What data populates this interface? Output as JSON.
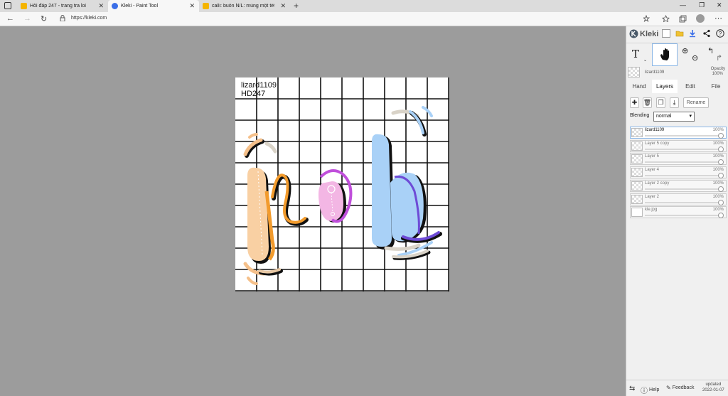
{
  "browser": {
    "tabs": [
      {
        "title": "Hỏi đáp 247 - trang tra loi",
        "favicon_color": "#f4b400"
      },
      {
        "title": "Kleki - Paint Tool",
        "favicon_color": "#3a6ee8"
      },
      {
        "title": "calli: buồn N/L: mùng một tết là",
        "favicon_color": "#f4b400"
      }
    ],
    "url": "https://kleki.com"
  },
  "canvas": {
    "text_line1": "lizard1109",
    "text_line2": "HD247"
  },
  "panel": {
    "logo": "Kleki",
    "current_layer": "lizard1109",
    "opacity_label": "Opacity",
    "opacity_value": "100%",
    "tabs": [
      "Hand",
      "Layers",
      "Edit",
      "File"
    ],
    "active_tab": "Layers",
    "rename_label": "Rename",
    "blending_label": "Blending",
    "blending_value": "normal",
    "layers": [
      {
        "name": "lizard1109",
        "opacity": "100%",
        "opacity_fraction": 1.0
      },
      {
        "name": "Layer 5 copy",
        "opacity": "100%",
        "opacity_fraction": 1.0
      },
      {
        "name": "Layer 5",
        "opacity": "100%",
        "opacity_fraction": 1.0
      },
      {
        "name": "Layer 4",
        "opacity": "100%",
        "opacity_fraction": 1.0
      },
      {
        "name": "Layer 2 copy",
        "opacity": "100%",
        "opacity_fraction": 1.0
      },
      {
        "name": "Layer 2",
        "opacity": "100%",
        "opacity_fraction": 1.0
      },
      {
        "name": "kle.jpg",
        "opacity": "100%",
        "opacity_fraction": 1.0
      }
    ],
    "help_label": "Help",
    "feedback_label": "Feedback",
    "updated_label": "updated",
    "updated_date": "2022-01-07"
  },
  "colors": {
    "workspace": "#9c9c9c",
    "accent_blue": "#3a6ee8",
    "orange": "#f5c08a",
    "pink": "#e79be6",
    "light_blue": "#a9d1f7",
    "purple": "#6e4bd6"
  }
}
